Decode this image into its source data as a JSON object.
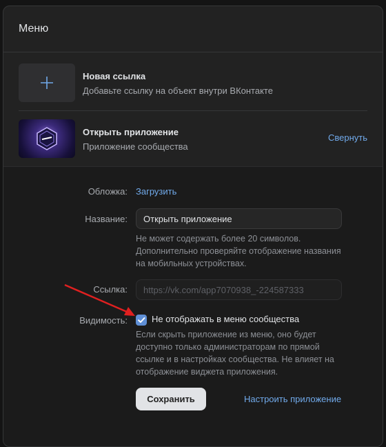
{
  "menu": {
    "title": "Меню",
    "items": [
      {
        "icon": "plus-icon",
        "title": "Новая ссылка",
        "subtitle": "Добавьте ссылку на объект внутри ВКонтакте"
      },
      {
        "icon": "app-cover-image",
        "title": "Открыть приложение",
        "subtitle": "Приложение сообщества",
        "action": "Свернуть"
      }
    ]
  },
  "settings": {
    "cover_label": "Обложка:",
    "cover_action": "Загрузить",
    "name_label": "Название:",
    "name_value": "Открыть приложение",
    "name_hint": "Не может содержать более 20 символов. Дополнительно проверяйте отображение названия на мобильных устройствах.",
    "link_label": "Ссылка:",
    "link_value": "https://vk.com/app7070938_-224587333",
    "visibility_label": "Видимость:",
    "visibility_checkbox_label": "Не отображать в меню сообщества",
    "visibility_checked": true,
    "visibility_hint": "Если скрыть приложение из меню, оно будет доступно только администраторам по прямой ссылке и в настройках сообщества. Не влияет на отображение виджета приложения.",
    "save_button": "Сохранить",
    "configure_link": "Настроить приложение"
  },
  "colors": {
    "accent": "#71aaeb",
    "checkbox": "#5f8fd6",
    "annotation_arrow": "#e02020"
  }
}
